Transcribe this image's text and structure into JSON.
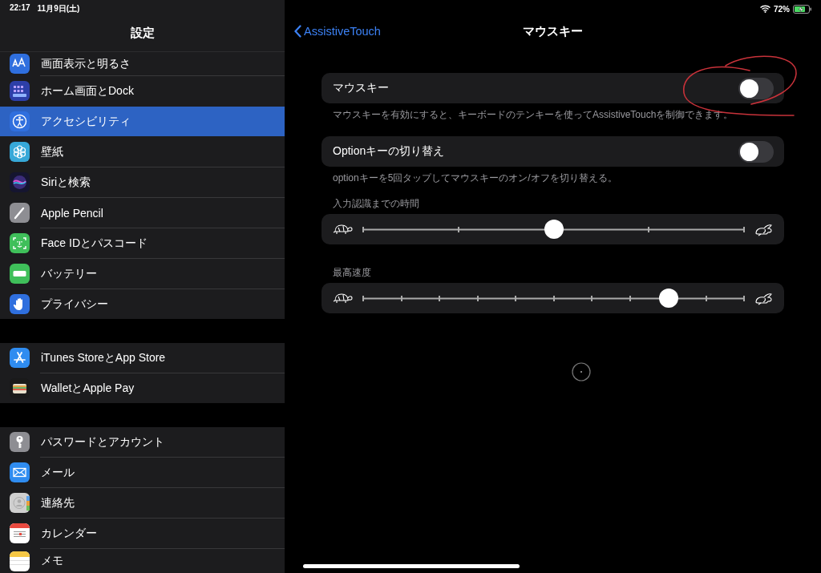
{
  "status_bar": {
    "time": "22:17",
    "date": "11月9日(土)",
    "battery_text": "72%",
    "charging": true
  },
  "sidebar": {
    "title": "設定",
    "groups": [
      {
        "items": [
          {
            "label": "画面表示と明るさ",
            "kind": "display",
            "selected": false
          },
          {
            "label": "ホーム画面とDock",
            "kind": "home",
            "selected": false
          },
          {
            "label": "アクセシビリティ",
            "kind": "accessibility",
            "selected": true
          },
          {
            "label": "壁紙",
            "kind": "wallpaper",
            "selected": false
          },
          {
            "label": "Siriと検索",
            "kind": "siri",
            "selected": false
          },
          {
            "label": "Apple Pencil",
            "kind": "pencil",
            "selected": false
          },
          {
            "label": "Face IDとパスコード",
            "kind": "faceid",
            "selected": false
          },
          {
            "label": "バッテリー",
            "kind": "battery",
            "selected": false
          },
          {
            "label": "プライバシー",
            "kind": "privacy",
            "selected": false
          }
        ]
      },
      {
        "items": [
          {
            "label": "iTunes StoreとApp Store",
            "kind": "appstore",
            "selected": false
          },
          {
            "label": "WalletとApple Pay",
            "kind": "wallet",
            "selected": false
          }
        ]
      },
      {
        "items": [
          {
            "label": "パスワードとアカウント",
            "kind": "password",
            "selected": false
          },
          {
            "label": "メール",
            "kind": "mail",
            "selected": false
          },
          {
            "label": "連絡先",
            "kind": "contacts",
            "selected": false
          },
          {
            "label": "カレンダー",
            "kind": "calendar",
            "selected": false
          },
          {
            "label": "メモ",
            "kind": "notes",
            "selected": false
          }
        ]
      }
    ]
  },
  "detail": {
    "back": "AssistiveTouch",
    "title": "マウスキー",
    "sections": [
      {
        "kind": "toggle",
        "label": "マウスキー",
        "on": false,
        "footer": "マウスキーを有効にすると、キーボードのテンキーを使ってAssistiveTouchを制御できます。"
      },
      {
        "kind": "toggle",
        "label": "Optionキーの切り替え",
        "on": false,
        "footer": "optionキーを5回タップしてマウスキーのオン/オフを切り替える。"
      },
      {
        "kind": "coarse-slider",
        "header": "入力認識までの時間",
        "level": 0.5
      },
      {
        "kind": "fine-slider",
        "header": "最高速度",
        "level": 0.8
      }
    ]
  },
  "annotations": [
    {
      "kind": "circle"
    }
  ]
}
